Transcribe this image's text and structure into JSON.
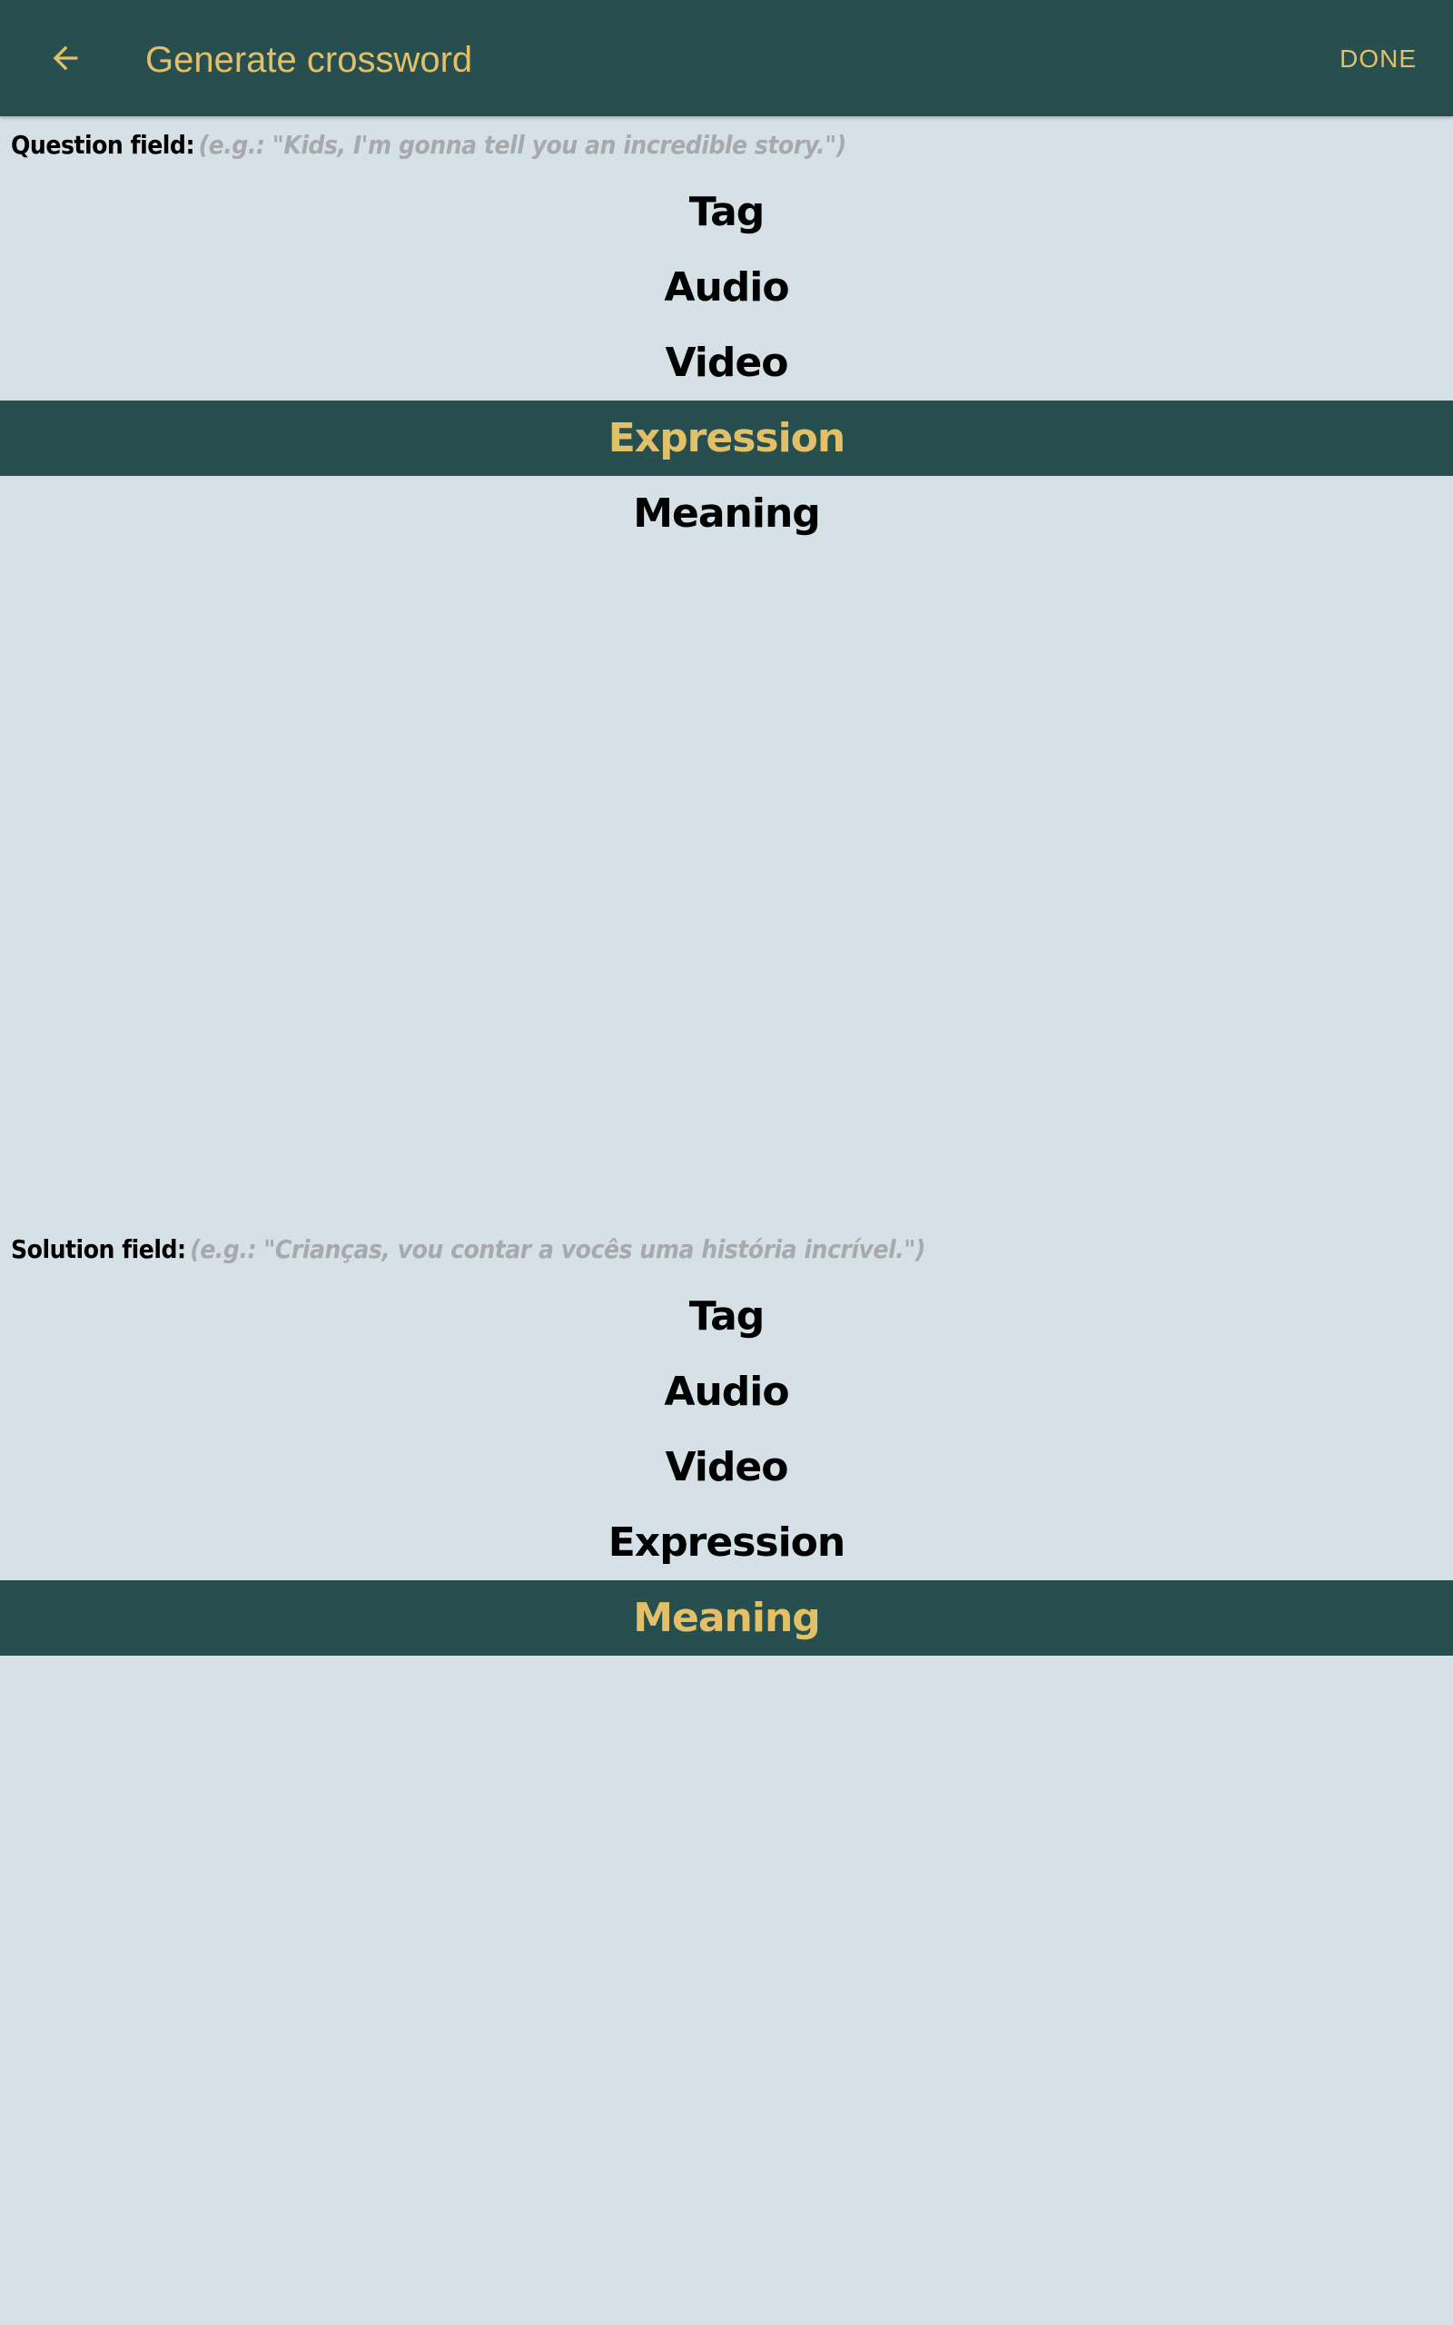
{
  "appbar": {
    "title": "Generate crossword",
    "done_label": "DONE",
    "back_icon": "arrow-left-icon",
    "accent_color": "#e2c068",
    "bar_color": "#284f4f"
  },
  "question": {
    "label": "Question field:",
    "placeholder": "(e.g.: \"Kids, I'm gonna tell you an incredible story.\")",
    "options": [
      "Tag",
      "Audio",
      "Video",
      "Expression",
      "Meaning"
    ],
    "selected": "Expression"
  },
  "solution": {
    "label": "Solution field:",
    "placeholder": "(e.g.: \"Crianças, vou contar a vocês uma história incrível.\")",
    "options": [
      "Tag",
      "Audio",
      "Video",
      "Expression",
      "Meaning"
    ],
    "selected": "Meaning"
  }
}
